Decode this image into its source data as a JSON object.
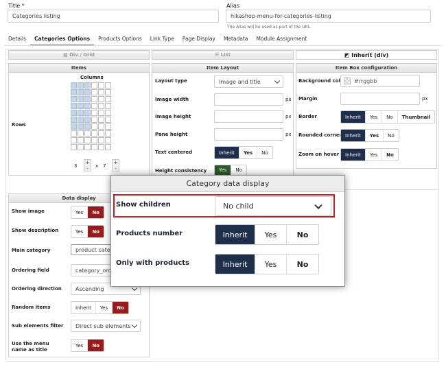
{
  "header": {
    "title_label": "Title *",
    "title_value": "Categories listing",
    "alias_label": "Alias",
    "alias_value": "hikashop-menu-for-categories-listing",
    "alias_hint": "The Alias will be used as part of the URL."
  },
  "tabs": [
    {
      "label": "Details"
    },
    {
      "label": "Categories Options",
      "active": true
    },
    {
      "label": "Products Options"
    },
    {
      "label": "Link Type"
    },
    {
      "label": "Page Display"
    },
    {
      "label": "Metadata"
    },
    {
      "label": "Module Assignment"
    }
  ],
  "layouts": {
    "div_grid": "Div / Grid",
    "list": "List",
    "inherit": "Inherit (div)"
  },
  "items_panel": {
    "title": "Items",
    "columns_label": "Columns",
    "rows_label": "Rows",
    "rows_value": "3",
    "columns_value": "7",
    "plus": "+",
    "minus": "-",
    "times": "x"
  },
  "item_layout": {
    "title": "Item Layout",
    "layout_type_label": "Layout type",
    "layout_type_value": "Image and title",
    "image_width_label": "Image width",
    "image_height_label": "Image height",
    "pane_height_label": "Pane height",
    "text_centered_label": "Text centered",
    "height_consistency_label": "Height consistency",
    "unit": "px",
    "options": {
      "inherit": "Inherit",
      "yes": "Yes",
      "no": "No"
    }
  },
  "item_box": {
    "title": "Item Box configuration",
    "bg_color_label": "Background color",
    "bg_color_placeholder": "#rrggbb",
    "margin_label": "Margin",
    "border_label": "Border",
    "border_thumbnail": "Thumbnail",
    "rounded_label": "Rounded corners",
    "zoom_label": "Zoom on hover",
    "unit": "px"
  },
  "data_display": {
    "title": "Data display",
    "show_image_label": "Show image",
    "show_description_label": "Show description",
    "main_category_label": "Main category",
    "main_category_value": "product categ",
    "ordering_field_label": "Ordering field",
    "ordering_field_value": "category_order",
    "ordering_direction_label": "Ordering direction",
    "ordering_direction_value": "Ascending",
    "random_items_label": "Random items",
    "sub_filter_label": "Sub elements filter",
    "sub_filter_value": "Direct sub elements",
    "use_menu_label_line1": "Use the menu",
    "use_menu_label_line2": "name as title"
  },
  "modal": {
    "title": "Category data display",
    "show_children_label": "Show children",
    "show_children_value": "No child",
    "products_number_label": "Products number",
    "only_with_products_label": "Only with products",
    "inherit": "Inherit",
    "yes": "Yes",
    "no": "No",
    "highlight_color": "#d11c1c"
  },
  "colors": {
    "accent": "#1e2f4c",
    "danger": "#9b1a1a",
    "tab_underline": "#1f6fb8"
  }
}
